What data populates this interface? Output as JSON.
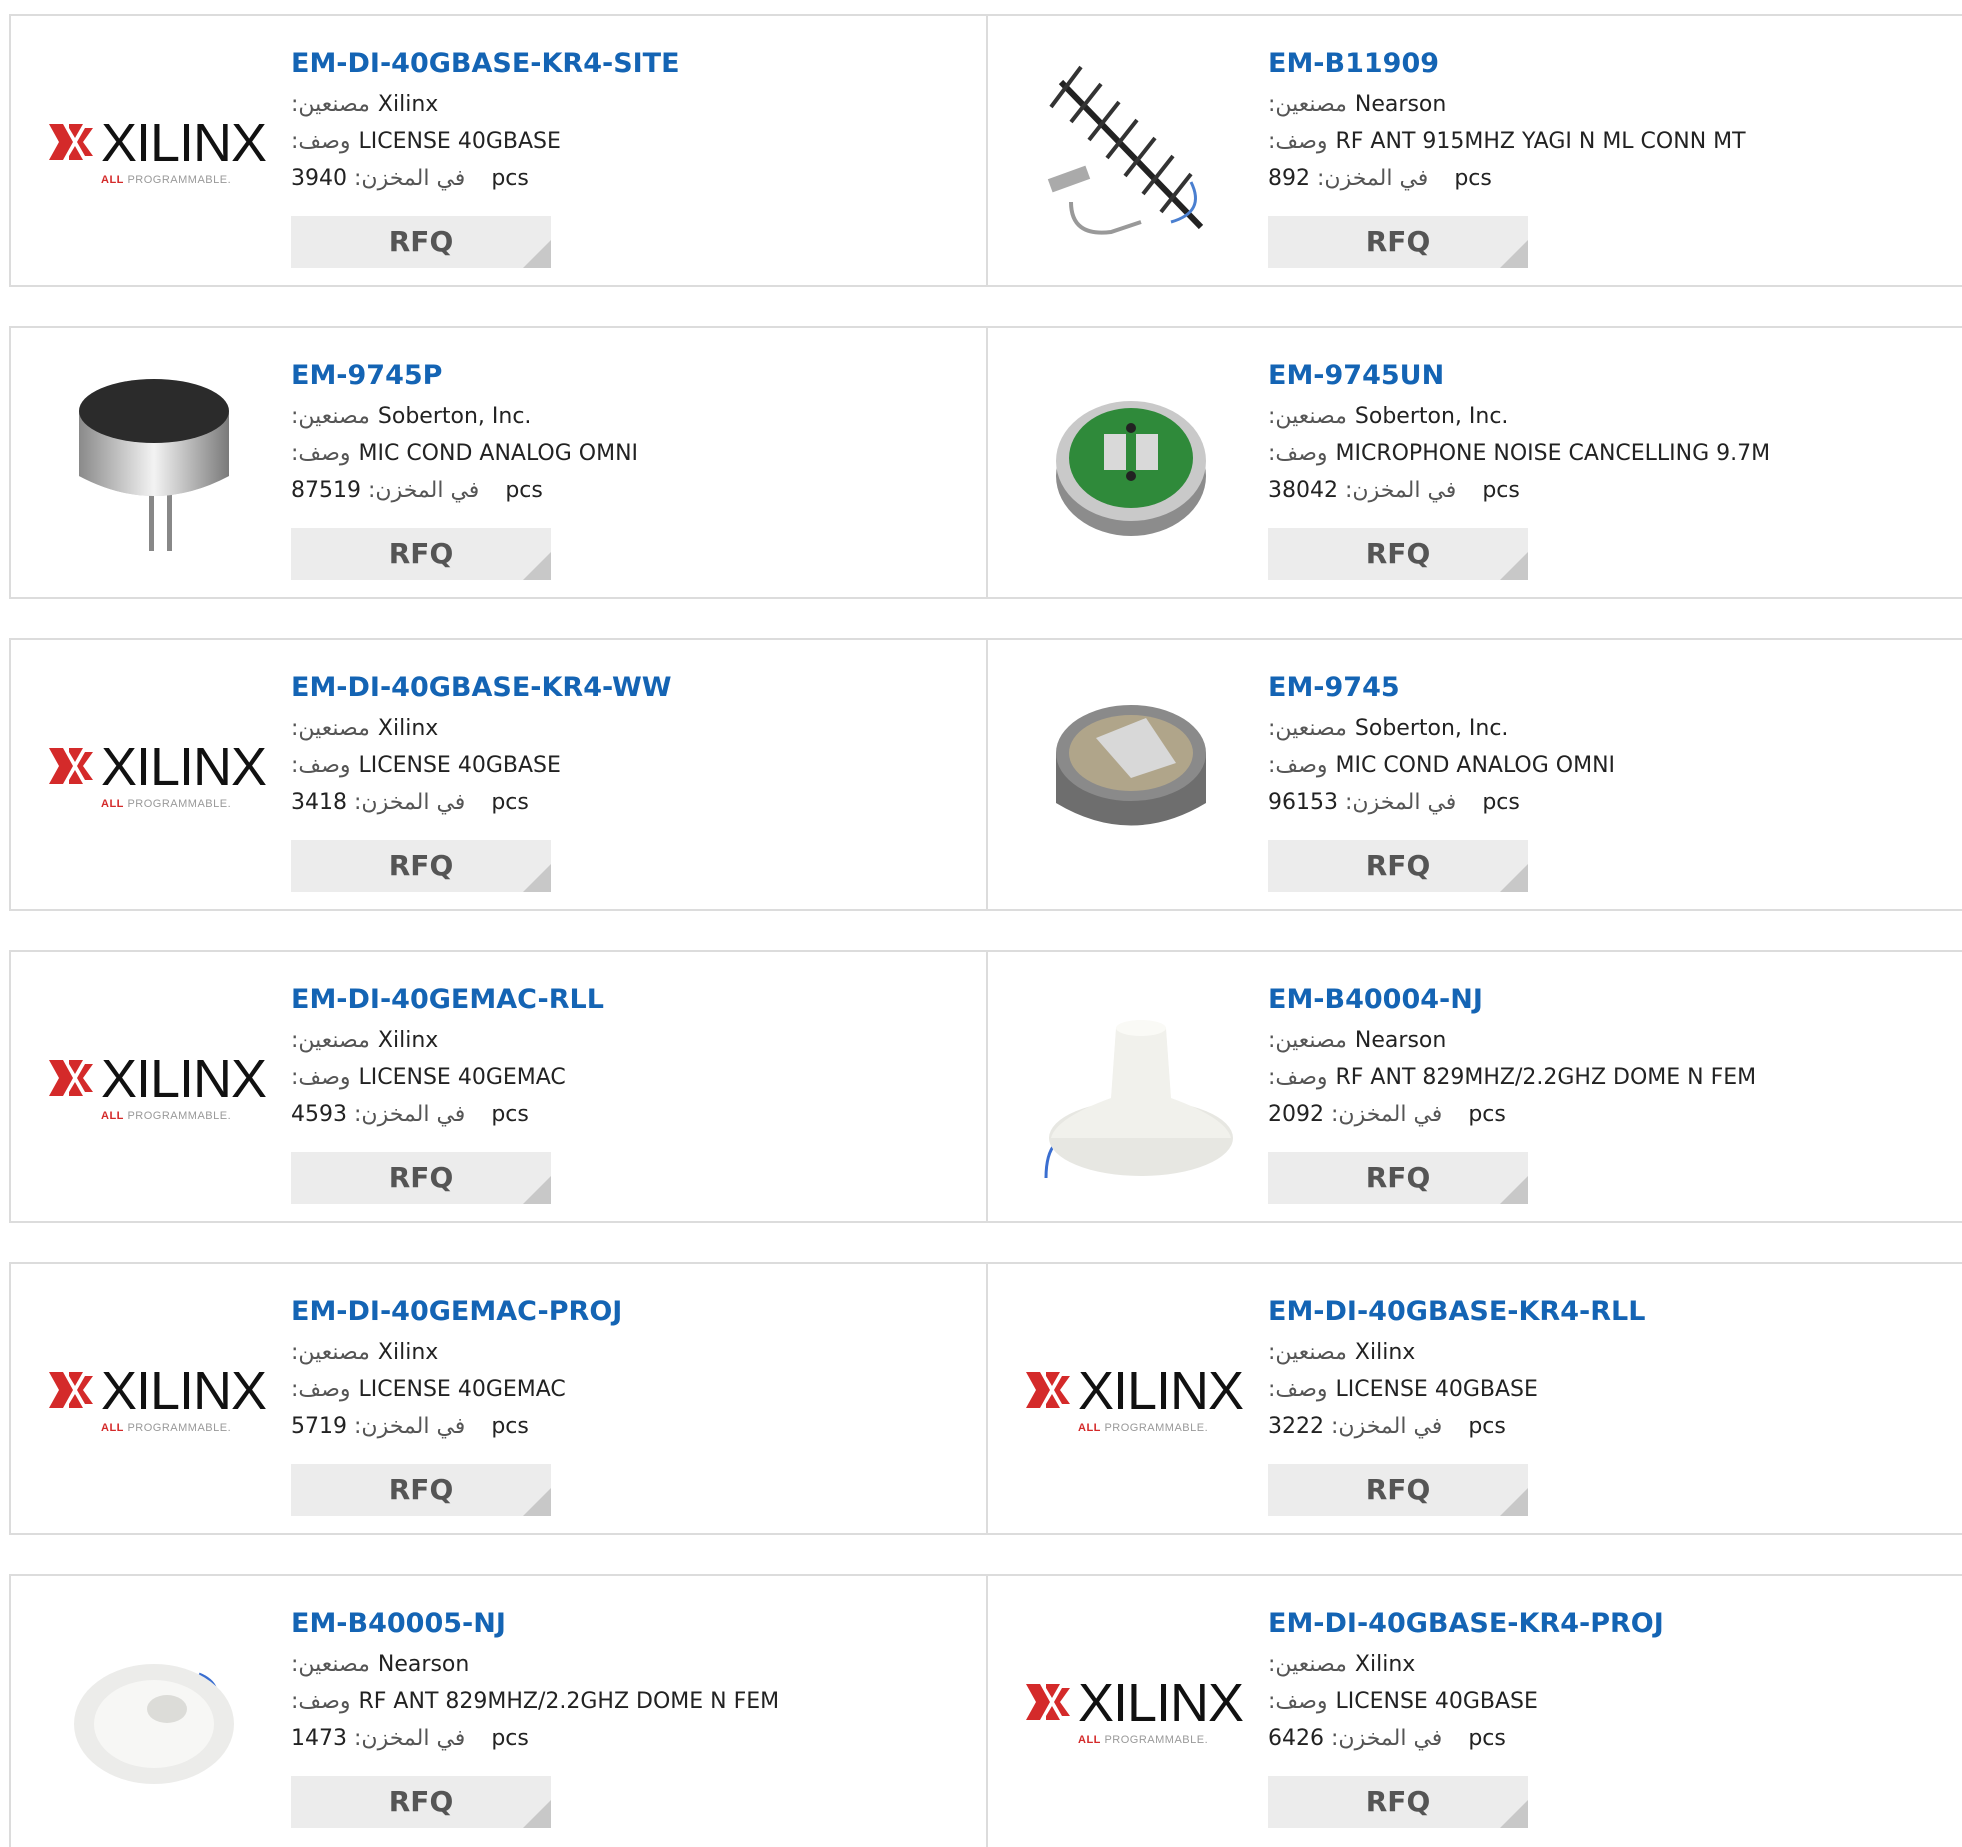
{
  "labels": {
    "manufacturer": ":مصنعين",
    "description": ":وصف",
    "stock": ":في المخزن",
    "unit": "pcs",
    "rfq": "RFQ"
  },
  "logo": {
    "brand": "XILINX",
    "tag_a": "ALL",
    "tag_b": "PROGRAMMABLE."
  },
  "products": [
    {
      "part": "EM-DI-40GBASE-KR4-SITE",
      "mfr": "Xilinx",
      "desc": "LICENSE 40GBASE",
      "stock": "3940",
      "image": "xilinx-logo"
    },
    {
      "part": "EM-B11909",
      "mfr": "Nearson",
      "desc": "RF ANT 915MHZ YAGI N ML CONN MT",
      "stock": "892",
      "image": "yagi-antenna"
    },
    {
      "part": "EM-9745P",
      "mfr": "Soberton, Inc.",
      "desc": "MIC COND ANALOG OMNI",
      "stock": "87519",
      "image": "microphone-pins"
    },
    {
      "part": "EM-9745UN",
      "mfr": "Soberton, Inc.",
      "desc": "MICROPHONE NOISE CANCELLING 9.7M",
      "stock": "38042",
      "image": "microphone-green-pcb"
    },
    {
      "part": "EM-DI-40GBASE-KR4-WW",
      "mfr": "Xilinx",
      "desc": "LICENSE 40GBASE",
      "stock": "3418",
      "image": "xilinx-logo"
    },
    {
      "part": "EM-9745",
      "mfr": "Soberton, Inc.",
      "desc": "MIC COND ANALOG OMNI",
      "stock": "96153",
      "image": "microphone-open"
    },
    {
      "part": "EM-DI-40GEMAC-RLL",
      "mfr": "Xilinx",
      "desc": "LICENSE 40GEMAC",
      "stock": "4593",
      "image": "xilinx-logo"
    },
    {
      "part": "EM-B40004-NJ",
      "mfr": "Nearson",
      "desc": "RF ANT 829MHZ/2.2GHZ DOME N FEM",
      "stock": "2092",
      "image": "dome-antenna"
    },
    {
      "part": "EM-DI-40GEMAC-PROJ",
      "mfr": "Xilinx",
      "desc": "LICENSE 40GEMAC",
      "stock": "5719",
      "image": "xilinx-logo"
    },
    {
      "part": "EM-DI-40GBASE-KR4-RLL",
      "mfr": "Xilinx",
      "desc": "LICENSE 40GBASE",
      "stock": "3222",
      "image": "xilinx-logo"
    },
    {
      "part": "EM-B40005-NJ",
      "mfr": "Nearson",
      "desc": "RF ANT 829MHZ/2.2GHZ DOME N FEM",
      "stock": "1473",
      "image": "dome-antenna-small"
    },
    {
      "part": "EM-DI-40GBASE-KR4-PROJ",
      "mfr": "Xilinx",
      "desc": "LICENSE 40GBASE",
      "stock": "6426",
      "image": "xilinx-logo"
    }
  ]
}
